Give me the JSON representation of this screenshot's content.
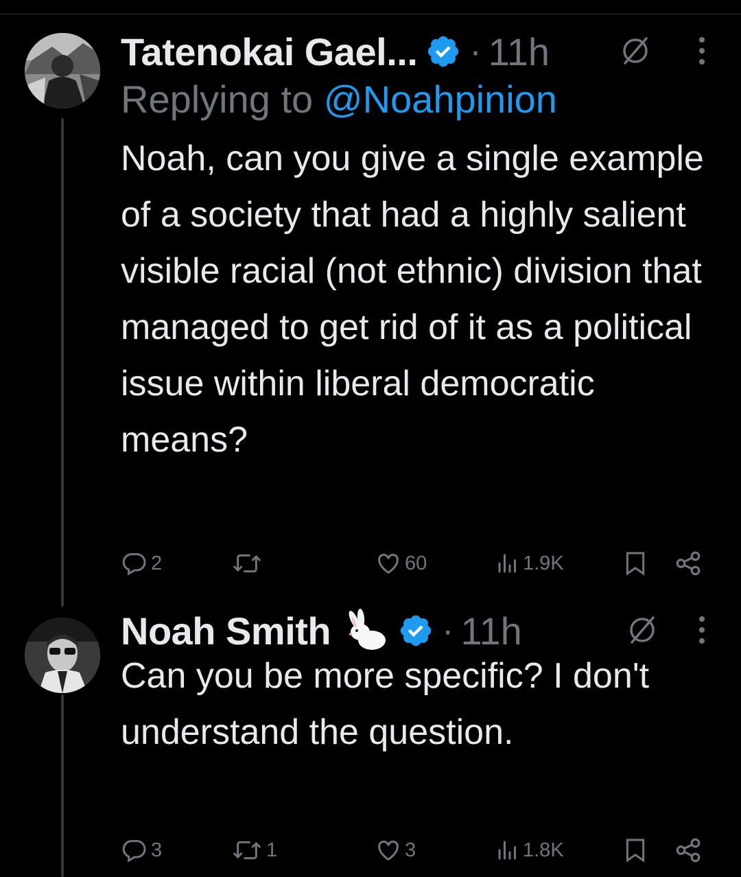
{
  "tweets": [
    {
      "author": "Tatenokai Gael...",
      "verified": true,
      "time": "11h",
      "replying_prefix": "Replying to ",
      "replying_handle": "@Noahpinion",
      "text": "Noah, can you give a single example of a society that had a highly salient visible racial (not ethnic) division that managed to get rid of it as a political issue within liberal democratic means?",
      "replies": "2",
      "retweets": "",
      "likes": "60",
      "views": "1.9K"
    },
    {
      "author": "Noah Smith",
      "author_emoji": "rabbit-emoji",
      "verified": true,
      "time": "11h",
      "text": "Can you be more specific? I don't understand the question.",
      "replies": "3",
      "retweets": "1",
      "likes": "3",
      "views": "1.8K"
    }
  ],
  "colors": {
    "background": "#000000",
    "text": "#e7e9ea",
    "muted": "#71767b",
    "accent": "#1d9bf0",
    "thread_line": "#333639"
  },
  "icons": [
    "verified-badge-icon",
    "grok-icon",
    "more-icon",
    "reply-icon",
    "retweet-icon",
    "like-icon",
    "views-icon",
    "bookmark-icon",
    "share-icon"
  ]
}
